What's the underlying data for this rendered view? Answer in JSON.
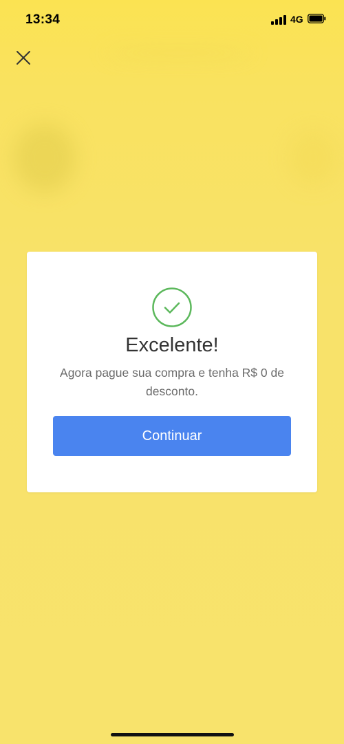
{
  "status_bar": {
    "time": "13:34",
    "network": "4G",
    "signal_bars": 4,
    "battery_level": 0.9
  },
  "header": {
    "close_icon": "close-icon"
  },
  "dialog": {
    "icon": "check-circle-icon",
    "title": "Excelente!",
    "message": "Agora pague sua compra e tenha R$ 0 de desconto.",
    "button_label": "Continuar"
  },
  "colors": {
    "background": "#f8e26a",
    "accent_blue": "#4a84ef",
    "success_green": "#5cb85c",
    "dialog_bg": "#ffffff"
  }
}
